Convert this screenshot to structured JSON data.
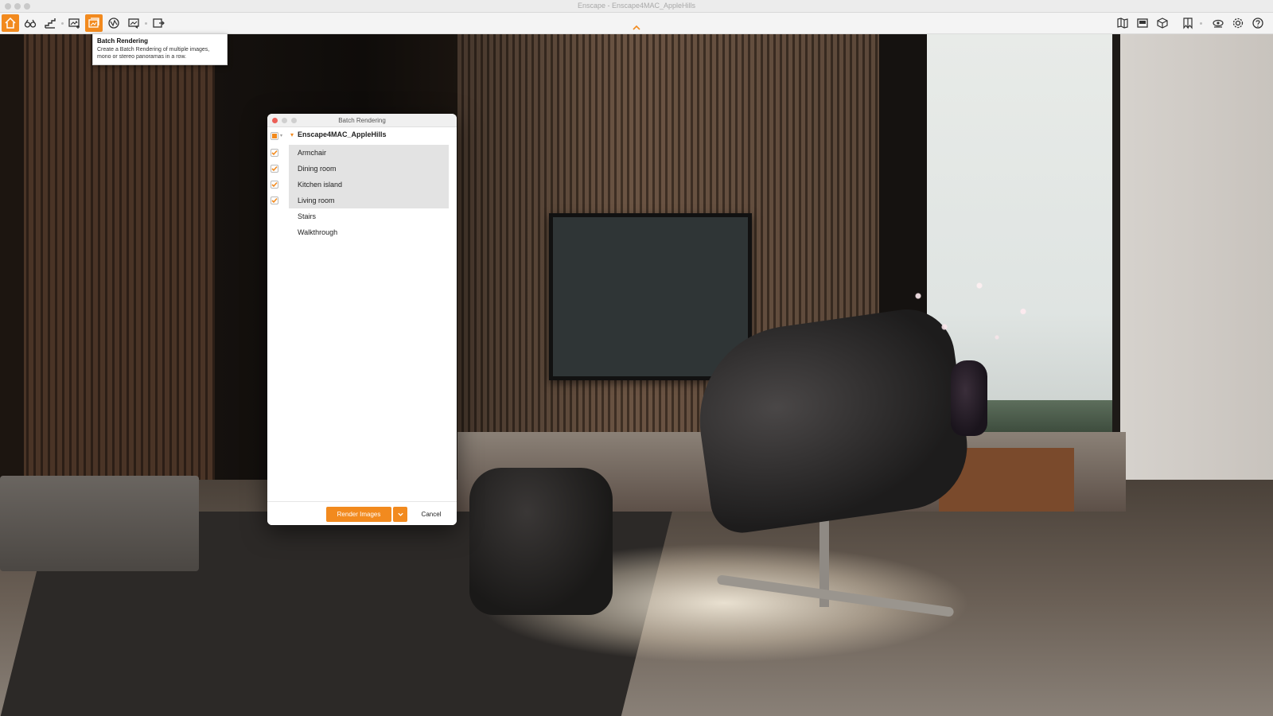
{
  "window": {
    "title": "Enscape - Enscape4MAC_AppleHills"
  },
  "colors": {
    "accent": "#f28a1e",
    "close": "#ec5f57",
    "toolbar_bg": "#f4f4f4"
  },
  "toolbar": {
    "left_icons": [
      "home-icon",
      "binoculars-icon",
      "stairs-icon",
      "screenshot-icon",
      "batch-rendering-icon",
      "render-360-icon",
      "video-editor-icon",
      "export-icon"
    ],
    "active_icon": "batch-rendering-icon",
    "right_icons": [
      "map-icon",
      "asset-library-icon",
      "material-editor-icon",
      "bookmark-icon",
      "visual-settings-icon",
      "settings-icon",
      "help-icon"
    ]
  },
  "tooltip": {
    "title": "Batch Rendering",
    "description": "Create a Batch Rendering of multiple images, mono or stereo panoramas in a row."
  },
  "dialog": {
    "title": "Batch Rendering",
    "root": {
      "label": "Enscape4MAC_AppleHills",
      "state": "partial"
    },
    "views": [
      {
        "label": "Armchair",
        "checked": true
      },
      {
        "label": "Dining room",
        "checked": true
      },
      {
        "label": "Kitchen island",
        "checked": true
      },
      {
        "label": "Living room",
        "checked": true
      },
      {
        "label": "Stairs",
        "checked": false
      },
      {
        "label": "Walkthrough",
        "checked": false
      }
    ],
    "render_button": "Render Images",
    "cancel_button": "Cancel"
  }
}
